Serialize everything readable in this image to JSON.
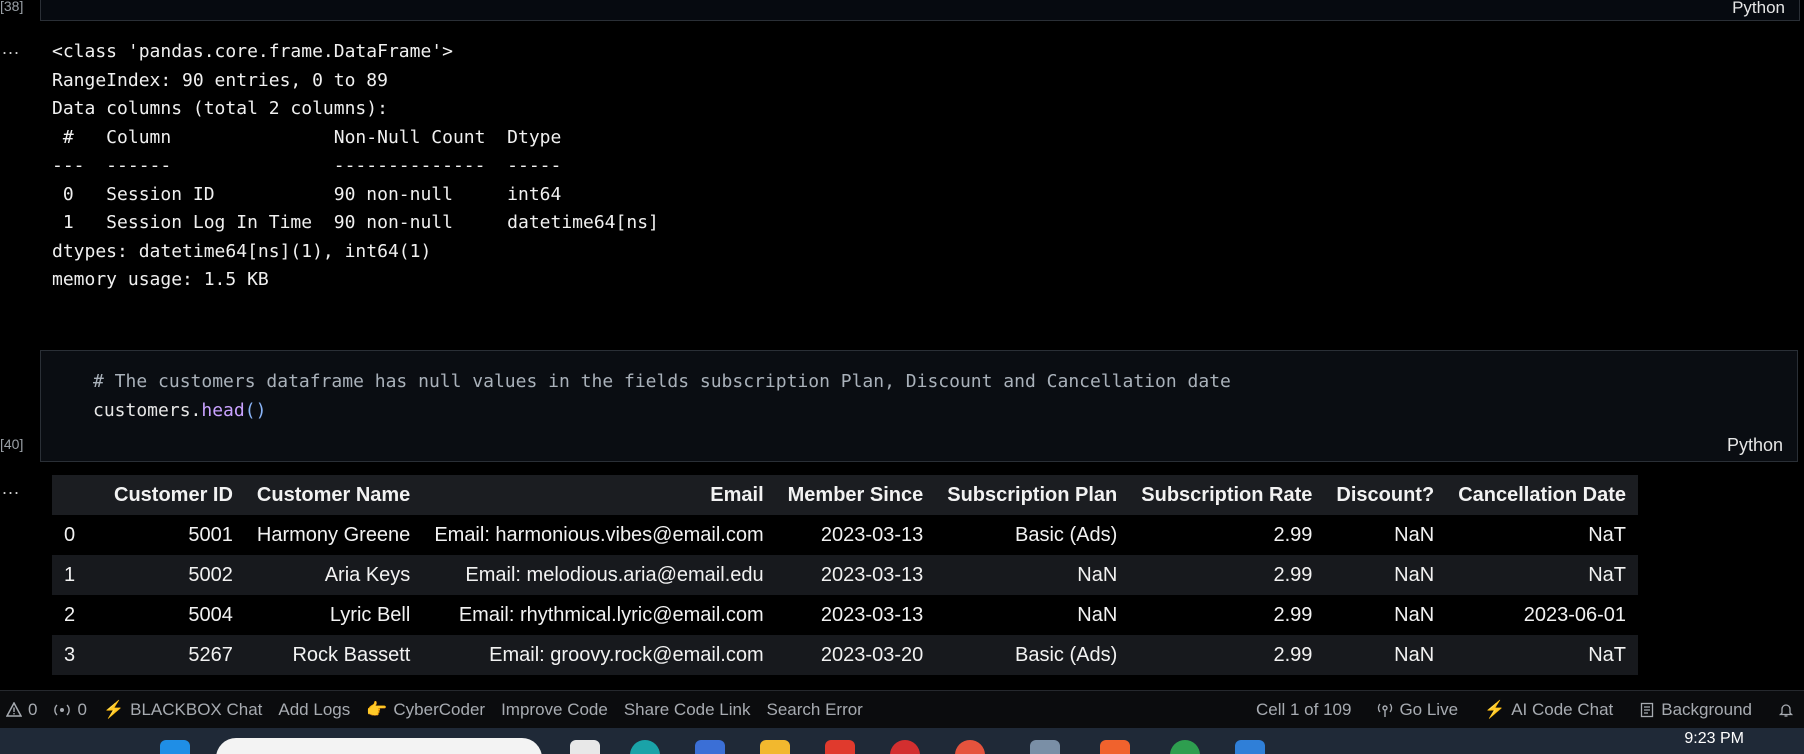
{
  "prev_cell": {
    "exec_count": "[38]",
    "language": "Python"
  },
  "info_output": {
    "marker": "...",
    "lines": [
      "<class 'pandas.core.frame.DataFrame'>",
      "RangeIndex: 90 entries, 0 to 89",
      "Data columns (total 2 columns):",
      " #   Column               Non-Null Count  Dtype",
      "---  ------               --------------  -----",
      " 0   Session ID           90 non-null     int64",
      " 1   Session Log In Time  90 non-null     datetime64[ns]",
      "dtypes: datetime64[ns](1), int64(1)",
      "memory usage: 1.5 KB"
    ]
  },
  "code_cell": {
    "exec_count": "[40]",
    "language": "Python",
    "comment": "# The customers dataframe has null values in the fields subscription Plan, Discount and Cancellation date",
    "code_obj": "customers.",
    "code_method": "head",
    "code_parens": "()"
  },
  "dataframe": {
    "marker": "...",
    "columns": [
      "",
      "Customer ID",
      "Customer Name",
      "Email",
      "Member Since",
      "Subscription Plan",
      "Subscription Rate",
      "Discount?",
      "Cancellation Date"
    ],
    "rows": [
      [
        "0",
        "5001",
        "Harmony Greene",
        "Email: harmonious.vibes@email.com",
        "2023-03-13",
        "Basic (Ads)",
        "2.99",
        "NaN",
        "NaT"
      ],
      [
        "1",
        "5002",
        "Aria Keys",
        "Email: melodious.aria@email.edu",
        "2023-03-13",
        "NaN",
        "2.99",
        "NaN",
        "NaT"
      ],
      [
        "2",
        "5004",
        "Lyric Bell",
        "Email: rhythmical.lyric@email.com",
        "2023-03-13",
        "NaN",
        "2.99",
        "NaN",
        "2023-06-01"
      ],
      [
        "3",
        "5267",
        "Rock Bassett",
        "Email: groovy.rock@email.com",
        "2023-03-20",
        "Basic (Ads)",
        "2.99",
        "NaN",
        "NaT"
      ]
    ]
  },
  "status_bar": {
    "errors": "0",
    "warnings": "0",
    "blackbox_chat": "BLACKBOX Chat",
    "add_logs": "Add Logs",
    "cybercoder": "CyberCoder",
    "improve_code": "Improve Code",
    "share_code_link": "Share Code Link",
    "search_error": "Search Error",
    "cell_position": "Cell 1 of 109",
    "go_live": "Go Live",
    "ai_code_chat": "AI Code Chat",
    "background": "Background"
  },
  "taskbar": {
    "time": "9:23 PM"
  },
  "colors": {
    "accent_orange": "#ff8c1a",
    "method_purple": "#c9a2ff",
    "paren_blue": "#8ab4f8"
  }
}
